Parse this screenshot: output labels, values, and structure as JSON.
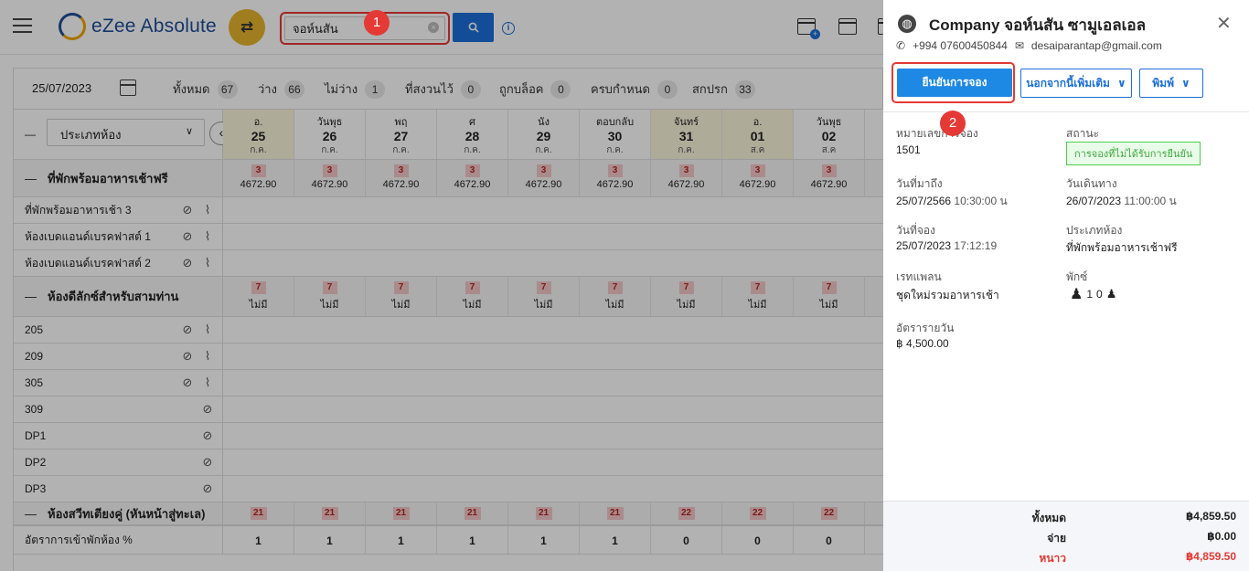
{
  "header": {
    "logo_text": "eZee Absolute",
    "search": {
      "value": "จอห์นสัน",
      "placeholder": ""
    },
    "markers": [
      "1",
      "2"
    ]
  },
  "filterbar": {
    "date": "25/07/2023",
    "stats": [
      {
        "label": "ทั้งหมด",
        "count": "67"
      },
      {
        "label": "ว่าง",
        "count": "66"
      },
      {
        "label": "ไม่ว่าง",
        "count": "1"
      },
      {
        "label": "ที่สงวนไว้",
        "count": "0"
      },
      {
        "label": "ถูกบล็อค",
        "count": "0"
      },
      {
        "label": "ครบกำหนด",
        "count": "0"
      },
      {
        "label": "สกปรก",
        "count": "33"
      }
    ]
  },
  "grid": {
    "roomtype_select": "ประเภทห้อง",
    "dates": [
      {
        "day": "อ.",
        "num": "25",
        "month": "ก.ค."
      },
      {
        "day": "วันพุธ",
        "num": "26",
        "month": "ก.ค."
      },
      {
        "day": "พฤ",
        "num": "27",
        "month": "ก.ค."
      },
      {
        "day": "ศ",
        "num": "28",
        "month": "ก.ค."
      },
      {
        "day": "นัง",
        "num": "29",
        "month": "ก.ค."
      },
      {
        "day": "ตอบกลับ",
        "num": "30",
        "month": "ก.ค."
      },
      {
        "day": "จันทร์",
        "num": "31",
        "month": "ก.ค."
      },
      {
        "day": "อ.",
        "num": "01",
        "month": "ส.ค"
      },
      {
        "day": "วันพุธ",
        "num": "02",
        "month": "ส.ค"
      }
    ],
    "groups": [
      {
        "name": "ที่พักพร้อมอาหารเช้าฟรี",
        "avail": [
          "3",
          "3",
          "3",
          "3",
          "3",
          "3",
          "3",
          "3",
          "3"
        ],
        "price": [
          "4672.90",
          "4672.90",
          "4672.90",
          "4672.90",
          "4672.90",
          "4672.90",
          "4672.90",
          "4672.90",
          "4672.90"
        ],
        "rooms": [
          "ที่พักพร้อมอาหารเช้า 3",
          "ห้องเบดแอนด์เบรคฟาสต์ 1",
          "ห้องเบดแอนด์เบรคฟาสต์ 2"
        ]
      },
      {
        "name": "ห้องดีลักซ์สำหรับสามท่าน",
        "avail": [
          "7",
          "7",
          "7",
          "7",
          "7",
          "7",
          "7",
          "7",
          "7"
        ],
        "price": [
          "ไม่มี",
          "ไม่มี",
          "ไม่มี",
          "ไม่มี",
          "ไม่มี",
          "ไม่มี",
          "ไม่มี",
          "ไม่มี",
          "ไม่มี"
        ],
        "rooms": [
          "205",
          "209",
          "305",
          "309",
          "DP1",
          "DP2",
          "DP3"
        ]
      },
      {
        "name": "ห้องสวีทเตียงคู่ (หันหน้าสู่ทะเล)",
        "avail": [
          "21",
          "21",
          "21",
          "21",
          "21",
          "21",
          "22",
          "22",
          "22"
        ]
      }
    ],
    "occupancy_label": "อัตราการเข้าพักห้อง %",
    "occupancy": [
      "1",
      "1",
      "1",
      "1",
      "1",
      "1",
      "0",
      "0",
      "0"
    ]
  },
  "panel": {
    "title": "Company จอห์นสัน ซามูเอลเอล",
    "phone": "+994 07600450844",
    "email": "desaiparantap@gmail.com",
    "confirm_btn": "ยืนยันการจอง",
    "more_btn": "นอกจากนี้เพิ่มเติม",
    "print_btn": "พิมพ์",
    "fields": {
      "res_no_label": "หมายเลขการจอง",
      "res_no": "1501",
      "status_label": "สถานะ",
      "status": "การจองที่ไม่ได้รับการยืนยัน",
      "arrival_label": "วันที่มาถึง",
      "arrival_date": "25/07/2566",
      "arrival_time": "10:30:00 น",
      "departure_label": "วันเดินทาง",
      "departure_date": "26/07/2023",
      "departure_time": "11:00:00 น",
      "booking_label": "วันที่จอง",
      "booking_date": "25/07/2023",
      "booking_time": "17:12:19",
      "roomtype_label": "ประเภทห้อง",
      "roomtype": "ที่พักพร้อมอาหารเช้าฟรี",
      "rateplan_label": "เรทแพลน",
      "rateplan": "ชุดใหม่รวมอาหารเช้า",
      "pax_label": "พักซ์",
      "pax_adult": "1",
      "pax_child": "0",
      "daily_rate_label": "อัตรารายวัน",
      "daily_rate": "฿ 4,500.00"
    },
    "footer": {
      "total_label": "ทั้งหมด",
      "total": "฿4,859.50",
      "paid_label": "จ่าย",
      "paid": "฿0.00",
      "balance_label": "หนาว",
      "balance": "฿4,859.50"
    },
    "colors": {
      "accent": "#1e6fd9",
      "balance": "#e53935"
    }
  }
}
